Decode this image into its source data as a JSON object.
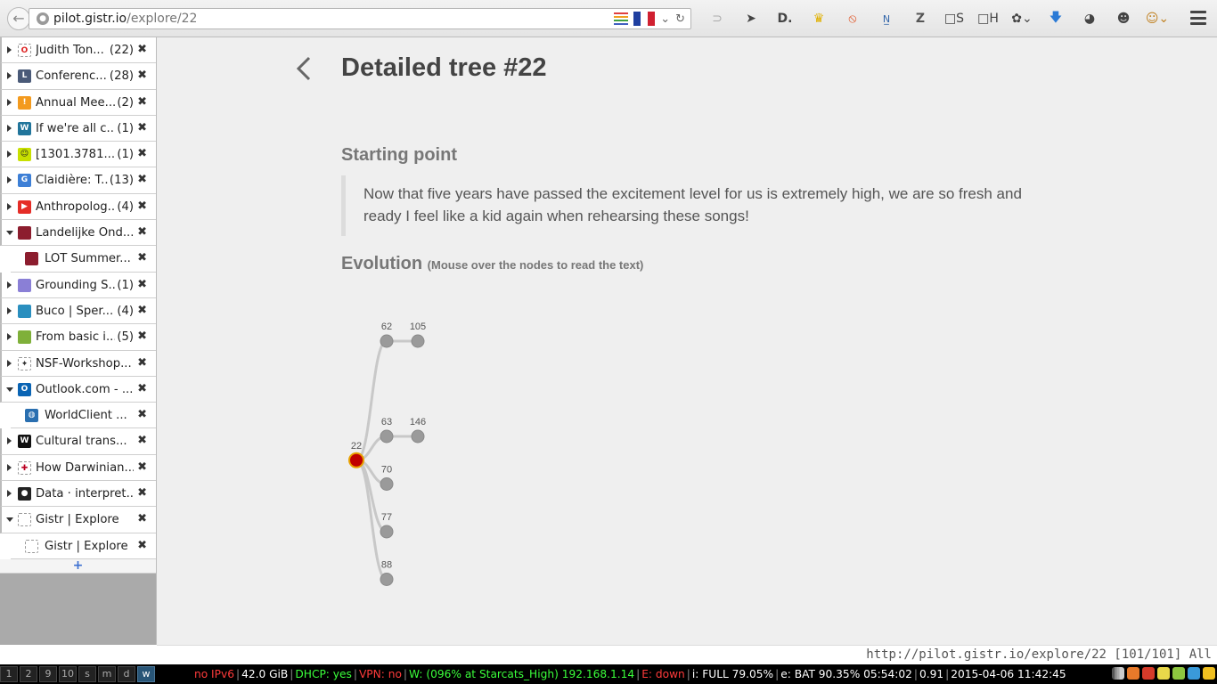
{
  "browser": {
    "url_host": "pilot.gistr.io",
    "url_path": "/explore/22",
    "toolbar_labels": {
      "s": "S",
      "h": "H"
    }
  },
  "sidebar": {
    "tabs": [
      {
        "title": "Judith Ton...",
        "count": "(22)",
        "child": false,
        "expanded": false,
        "fav_bg": "#ffffff",
        "fav_fg": "#d22",
        "fav_text": "O"
      },
      {
        "title": "Conferenc...",
        "count": "(28)",
        "child": false,
        "expanded": false,
        "fav_bg": "#4a5a78",
        "fav_fg": "#fff",
        "fav_text": "L"
      },
      {
        "title": "Annual Mee...",
        "count": "(2)",
        "child": false,
        "expanded": false,
        "fav_bg": "#f39a1e",
        "fav_fg": "#fff",
        "fav_text": "!"
      },
      {
        "title": "If we're all c...",
        "count": "(1)",
        "child": false,
        "expanded": false,
        "fav_bg": "#21759b",
        "fav_fg": "#fff",
        "fav_text": "W"
      },
      {
        "title": "[1301.3781...",
        "count": "(1)",
        "child": false,
        "expanded": false,
        "fav_bg": "#c8e000",
        "fav_fg": "#222",
        "fav_text": "☺"
      },
      {
        "title": "Claidière: T...",
        "count": "(13)",
        "child": false,
        "expanded": false,
        "fav_bg": "#3d7fd6",
        "fav_fg": "#fff",
        "fav_text": "G"
      },
      {
        "title": "Anthropolog...",
        "count": "(4)",
        "child": false,
        "expanded": false,
        "fav_bg": "#e52d27",
        "fav_fg": "#fff",
        "fav_text": "▶"
      },
      {
        "title": "Landelijke Ond...",
        "count": "",
        "child": false,
        "expanded": true,
        "fav_bg": "#8c1d2e",
        "fav_fg": "#fff",
        "fav_text": ""
      },
      {
        "title": "LOT Summer...",
        "count": "",
        "child": true,
        "expanded": false,
        "fav_bg": "#8c1d2e",
        "fav_fg": "#fff",
        "fav_text": ""
      },
      {
        "title": "Grounding S...",
        "count": "(1)",
        "child": false,
        "expanded": false,
        "fav_bg": "#8a7fd6",
        "fav_fg": "#fff",
        "fav_text": ""
      },
      {
        "title": "Buco | Sper...",
        "count": "(4)",
        "child": false,
        "expanded": false,
        "fav_bg": "#2a8fbf",
        "fav_fg": "#fff",
        "fav_text": ""
      },
      {
        "title": "From basic i...",
        "count": "(5)",
        "child": false,
        "expanded": false,
        "fav_bg": "#7fb03a",
        "fav_fg": "#fff",
        "fav_text": ""
      },
      {
        "title": "NSF-Workshop...",
        "count": "",
        "child": false,
        "expanded": false,
        "fav_bg": "#ffffff",
        "fav_fg": "#333",
        "fav_text": "✦"
      },
      {
        "title": "Outlook.com - ...",
        "count": "",
        "child": false,
        "expanded": true,
        "fav_bg": "#0a64b4",
        "fav_fg": "#fff",
        "fav_text": "O"
      },
      {
        "title": "WorldClient ...",
        "count": "",
        "child": true,
        "expanded": false,
        "fav_bg": "#2a6fb0",
        "fav_fg": "#fff",
        "fav_text": "◍"
      },
      {
        "title": "Cultural trans...",
        "count": "",
        "child": false,
        "expanded": false,
        "fav_bg": "#111111",
        "fav_fg": "#fff",
        "fav_text": "W"
      },
      {
        "title": "How Darwinian...",
        "count": "",
        "child": false,
        "expanded": false,
        "fav_bg": "#ffffff",
        "fav_fg": "#b02",
        "fav_text": "✚"
      },
      {
        "title": "Data · interpret...",
        "count": "",
        "child": false,
        "expanded": false,
        "fav_bg": "#222222",
        "fav_fg": "#fff",
        "fav_text": "●"
      },
      {
        "title": "Gistr | Explore",
        "count": "",
        "child": false,
        "expanded": true,
        "fav_bg": "#ffffff",
        "fav_fg": "#777",
        "fav_text": ""
      },
      {
        "title": "Gistr | Explore",
        "count": "",
        "child": true,
        "expanded": false,
        "fav_bg": "#ffffff",
        "fav_fg": "#777",
        "fav_text": ""
      }
    ],
    "new_tab_label": "+"
  },
  "page": {
    "title": "Detailed tree #22",
    "starting_point_heading": "Starting point",
    "starting_point_text": "Now that five years have passed the excitement level for us is extremely high, we are so fresh and ready I feel like a kid again when rehearsing these songs!",
    "evolution_heading": "Evolution",
    "evolution_hint": "(Mouse over the nodes to read the text)"
  },
  "tree": {
    "root": {
      "id": "22",
      "color": "#c00000"
    },
    "nodes": [
      {
        "id": "62",
        "parent": "22",
        "depth": 1,
        "row": 0
      },
      {
        "id": "105",
        "parent": "62",
        "depth": 2,
        "row": 0
      },
      {
        "id": "63",
        "parent": "22",
        "depth": 1,
        "row": 2
      },
      {
        "id": "146",
        "parent": "63",
        "depth": 2,
        "row": 2
      },
      {
        "id": "70",
        "parent": "22",
        "depth": 1,
        "row": 3
      },
      {
        "id": "77",
        "parent": "22",
        "depth": 1,
        "row": 4
      },
      {
        "id": "88",
        "parent": "22",
        "depth": 1,
        "row": 5
      }
    ],
    "root_row": 2.5,
    "node_color": "#9a9a9a",
    "link_color": "#c8c8c8"
  },
  "status_url": "http://pilot.gistr.io/explore/22 [101/101] All",
  "sysbar": {
    "workspaces": [
      "1",
      "2",
      "9",
      "10",
      "s",
      "m",
      "d",
      "w"
    ],
    "active_workspace": "w",
    "items": [
      {
        "text": "no IPv6",
        "color": "#ff3b3b"
      },
      {
        "text": "42.0 GiB",
        "color": "#ffffff"
      },
      {
        "text": "DHCP: yes",
        "color": "#3bff3b"
      },
      {
        "text": "VPN: no",
        "color": "#ff3b3b"
      },
      {
        "text": "W: (096% at Starcats_High) 192.168.1.14",
        "color": "#3bff3b"
      },
      {
        "text": "E: down",
        "color": "#ff3b3b"
      },
      {
        "text": "i: FULL 79.05%",
        "color": "#ffffff"
      },
      {
        "text": "e: BAT 90.35% 05:54:02",
        "color": "#ffffff"
      },
      {
        "text": "0.91",
        "color": "#ffffff"
      },
      {
        "text": "2015-04-06 11:42:45",
        "color": "#ffffff"
      }
    ]
  }
}
